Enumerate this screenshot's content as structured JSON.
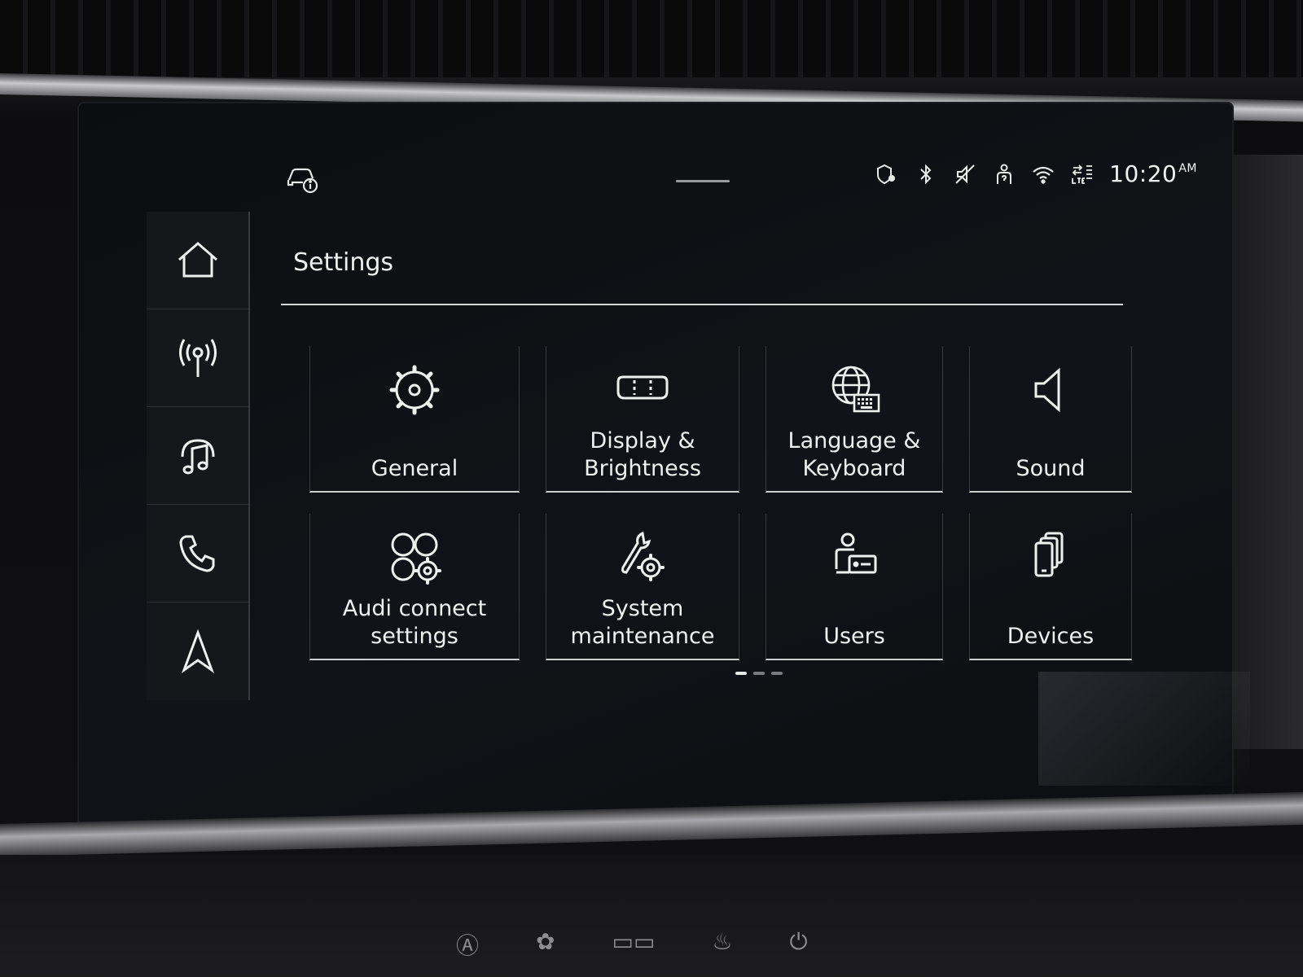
{
  "page": {
    "title": "Settings"
  },
  "status_bar": {
    "time": "10:20",
    "ampm": "AM",
    "icons": [
      "car-info-icon",
      "location-icon",
      "bluetooth-icon",
      "mute-icon",
      "privacy-user-icon",
      "wifi-icon",
      "lte-data-icon"
    ]
  },
  "sidenav": {
    "items": [
      {
        "name": "home",
        "icon": "home-icon"
      },
      {
        "name": "radio",
        "icon": "radio-antenna-icon"
      },
      {
        "name": "media",
        "icon": "music-note-icon"
      },
      {
        "name": "phone",
        "icon": "phone-icon"
      },
      {
        "name": "navigation",
        "icon": "navigation-arrow-icon"
      }
    ]
  },
  "tiles": [
    {
      "label": "General",
      "icon": "gear-icon"
    },
    {
      "label": "Display &\nBrightness",
      "icon": "display-icon"
    },
    {
      "label": "Language &\nKeyboard",
      "icon": "globe-keyboard-icon"
    },
    {
      "label": "Sound",
      "icon": "speaker-icon"
    },
    {
      "label": "Audi connect\nsettings",
      "icon": "connect-rings-icon"
    },
    {
      "label": "System\nmaintenance",
      "icon": "wrench-gear-icon"
    },
    {
      "label": "Users",
      "icon": "user-card-icon"
    },
    {
      "label": "Devices",
      "icon": "devices-icon"
    }
  ],
  "pager": {
    "active_page": 1,
    "page_count": 3
  },
  "colors": {
    "screen_bg": "#111318",
    "text": "#f0f0f0",
    "tile_rule": "#cfcfcf"
  }
}
